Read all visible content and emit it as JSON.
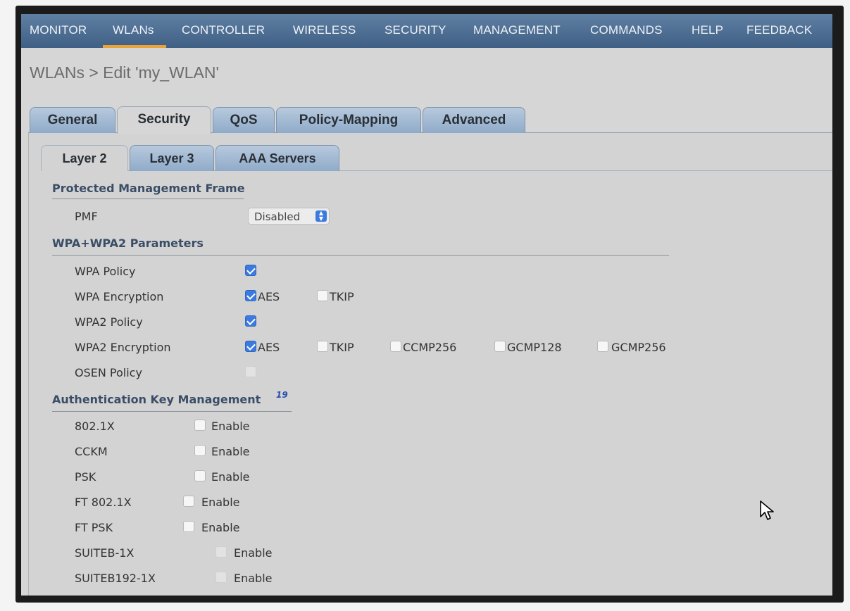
{
  "nav": {
    "items": [
      {
        "label": "MONITOR"
      },
      {
        "label": "WLANs"
      },
      {
        "label": "CONTROLLER"
      },
      {
        "label": "WIRELESS"
      },
      {
        "label": "SECURITY"
      },
      {
        "label": "MANAGEMENT"
      },
      {
        "label": "COMMANDS"
      },
      {
        "label": "HELP"
      },
      {
        "label": "FEEDBACK"
      }
    ],
    "active": "WLANs"
  },
  "page": {
    "title": "WLANs > Edit  'my_WLAN'"
  },
  "tabs": [
    {
      "label": "General"
    },
    {
      "label": "Security"
    },
    {
      "label": "QoS"
    },
    {
      "label": "Policy-Mapping"
    },
    {
      "label": "Advanced"
    }
  ],
  "active_tab": "Security",
  "subtabs": [
    {
      "label": "Layer 2"
    },
    {
      "label": "Layer 3"
    },
    {
      "label": "AAA Servers"
    }
  ],
  "active_subtab": "Layer 2",
  "pmf_section": {
    "heading": "Protected Management Frame",
    "pmf_label": "PMF",
    "pmf_value": "Disabled"
  },
  "wpa_section": {
    "heading": "WPA+WPA2 Parameters",
    "wpa_policy_label": "WPA Policy",
    "wpa_policy_checked": true,
    "wpa_encryption_label": "WPA Encryption",
    "wpa_aes": "AES",
    "wpa_tkip": "TKIP",
    "wpa2_policy_label": "WPA2 Policy",
    "wpa2_policy_checked": true,
    "wpa2_encryption_label": "WPA2 Encryption",
    "wpa2_aes": "AES",
    "wpa2_tkip": "TKIP",
    "wpa2_ccmp256": "CCMP256",
    "wpa2_gcmp128": "GCMP128",
    "wpa2_gcmp256": "GCMP256",
    "osen_label": "OSEN Policy"
  },
  "akm_section": {
    "heading": "Authentication Key Management",
    "footnote": "19",
    "rows": [
      {
        "label": "802.1X",
        "option": "Enable"
      },
      {
        "label": "CCKM",
        "option": "Enable"
      },
      {
        "label": "PSK",
        "option": "Enable"
      },
      {
        "label": "FT 802.1X",
        "option": "Enable"
      },
      {
        "label": "FT PSK",
        "option": "Enable"
      },
      {
        "label": "SUITEB-1X",
        "option": "Enable"
      },
      {
        "label": "SUITEB192-1X",
        "option": "Enable"
      }
    ]
  },
  "colors": {
    "nav_bg": "#4c6d93",
    "nav_active_underline": "#e8a33a",
    "tab_bg": "#9fb8d4",
    "checkbox_checked": "#3b7be0",
    "section_heading": "#3a4d66"
  },
  "icons": {
    "select_arrows": "up-down-chevron-icon",
    "cursor": "mouse-pointer-icon"
  }
}
